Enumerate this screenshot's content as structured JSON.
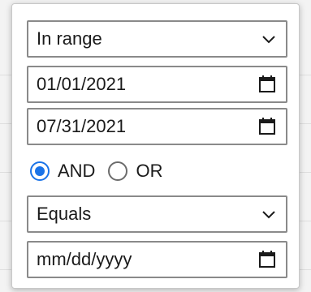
{
  "filter": {
    "condition1": {
      "operator": "In range",
      "from": "01/01/2021",
      "to": "07/31/2021"
    },
    "join": {
      "options": [
        "AND",
        "OR"
      ],
      "selected": "AND"
    },
    "condition2": {
      "operator": "Equals",
      "placeholder": "mm/dd/yyyy"
    }
  },
  "icons": {
    "dropdown": "chevron-down-icon",
    "date": "calendar-icon"
  },
  "colors": {
    "accent": "#1a73e8",
    "border": "#8a8a8a",
    "text": "#1a1a1a"
  }
}
